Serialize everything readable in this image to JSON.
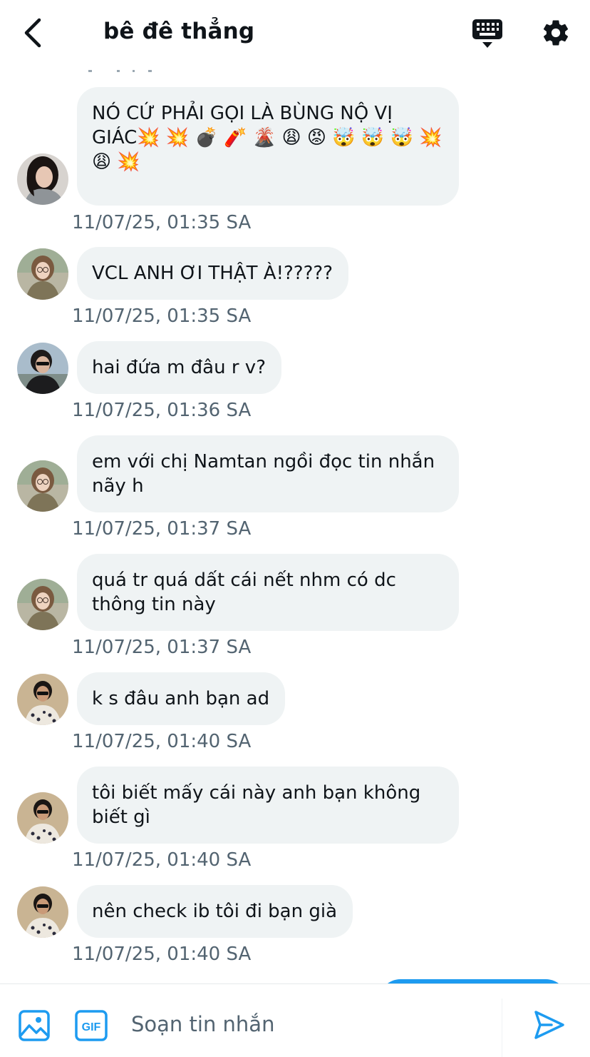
{
  "header": {
    "title": "bê đê thẳng"
  },
  "messages": [
    {
      "text": "NÓ CỨ PHẢI GỌI LÀ BÙNG NỘ VỊ GIÁC💥 💥 💣 🧨 🌋 😩 😡 🤯 🤯 🤯 💥 😩 💥",
      "time": "11/07/25, 01:35 SA",
      "avatar": "girl-gray-shirt"
    },
    {
      "text": "VCL ANH ƠI THẬT À!?????",
      "time": "11/07/25, 01:35 SA",
      "avatar": "girl-glasses"
    },
    {
      "text": "hai đứa m đâu r v?",
      "time": "11/07/25, 01:36 SA",
      "avatar": "guy-sunglasses-dark"
    },
    {
      "text": "em với chị Namtan ngồi đọc tin nhắn nãy h",
      "time": "11/07/25, 01:37 SA",
      "avatar": "girl-glasses"
    },
    {
      "text": "quá tr quá dất cái nết nhm có dc thông tin này",
      "time": "11/07/25, 01:37 SA",
      "avatar": "girl-glasses"
    },
    {
      "text": "k s đâu anh bạn ad",
      "time": "11/07/25, 01:40 SA",
      "avatar": "guy-patterned-shirt"
    },
    {
      "text": "tôi biết mấy cái này anh bạn không biết gì",
      "time": "11/07/25, 01:40 SA",
      "avatar": "guy-patterned-shirt"
    },
    {
      "text": "nên check ib tôi đi bạn già",
      "time": "11/07/25, 01:40 SA",
      "avatar": "guy-patterned-shirt"
    }
  ],
  "composer": {
    "placeholder": "Soạn tin nhắn",
    "gif_label": "GIF"
  },
  "colors": {
    "accent": "#1d9bf0",
    "bubble": "#eff3f4",
    "timestamp": "#536471"
  }
}
